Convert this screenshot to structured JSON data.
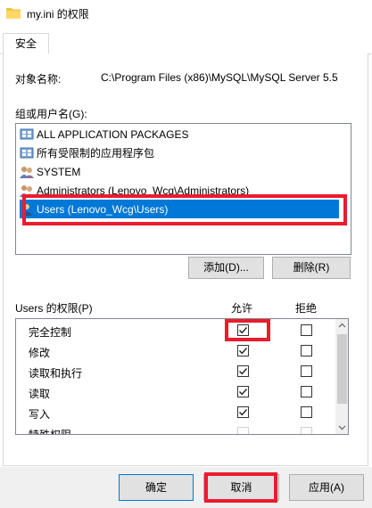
{
  "window": {
    "title": "my.ini 的权限"
  },
  "tabs": [
    {
      "label": "安全"
    }
  ],
  "object": {
    "label": "对象名称:",
    "value": "C:\\Program Files (x86)\\MySQL\\MySQL Server 5.5"
  },
  "groups": {
    "label": "组或用户名(G):",
    "items": [
      {
        "label": "ALL APPLICATION PACKAGES",
        "icon": "package-group-icon"
      },
      {
        "label": "所有受限制的应用程序包",
        "icon": "package-group-icon"
      },
      {
        "label": "SYSTEM",
        "icon": "users-group-icon"
      },
      {
        "label": "Administrators (Lenovo_Wcg\\Administrators)",
        "icon": "users-group-icon"
      },
      {
        "label": "Users (Lenovo_Wcg\\Users)",
        "icon": "user-icon",
        "selected": true
      }
    ],
    "add_label": "添加(D)...",
    "remove_label": "删除(R)"
  },
  "permissions": {
    "label": "Users 的权限(P)",
    "allow_label": "允许",
    "deny_label": "拒绝",
    "rows": [
      {
        "name": "完全控制",
        "allow": true,
        "deny": false
      },
      {
        "name": "修改",
        "allow": true,
        "deny": false
      },
      {
        "name": "读取和执行",
        "allow": true,
        "deny": false
      },
      {
        "name": "读取",
        "allow": true,
        "deny": false
      },
      {
        "name": "写入",
        "allow": true,
        "deny": false
      },
      {
        "name": "特殊权限",
        "allow": false,
        "deny": false
      }
    ]
  },
  "footer": {
    "ok_label": "确定",
    "cancel_label": "取消",
    "apply_label": "应用(A)"
  },
  "colors": {
    "selection": "#0078d7",
    "highlight_box": "#ea1c2d",
    "button_face": "#e1e1e1"
  }
}
